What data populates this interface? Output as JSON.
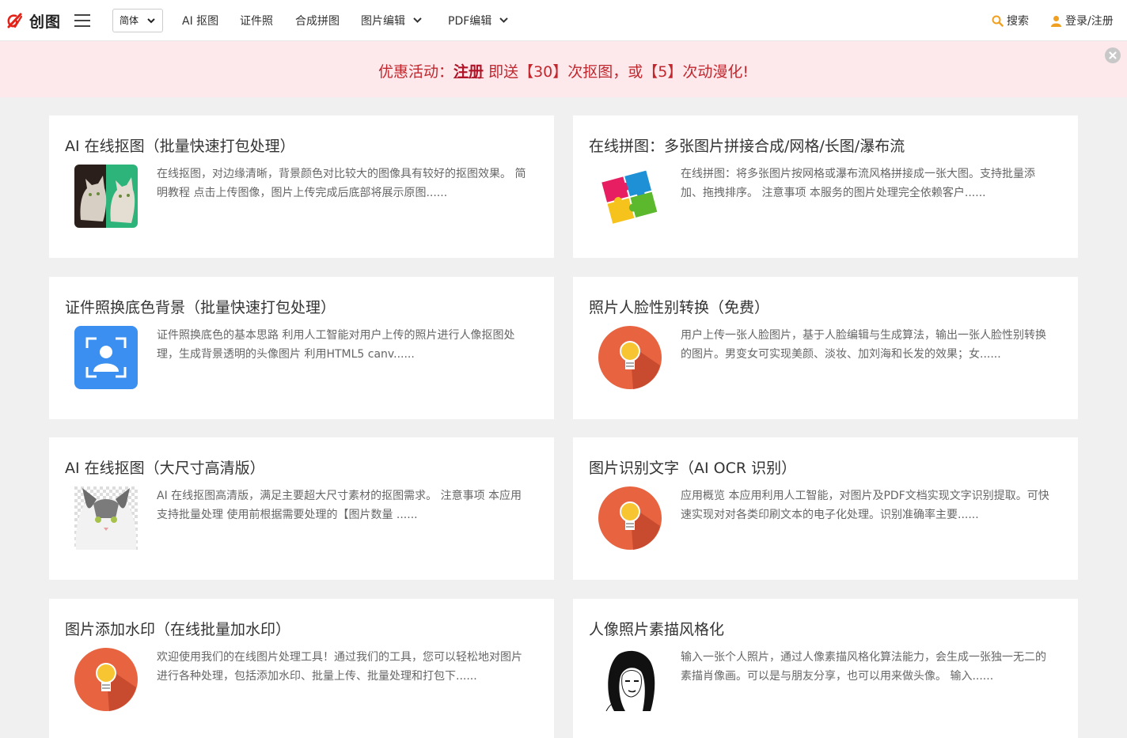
{
  "brand": {
    "name": "创图"
  },
  "header": {
    "language": "简体",
    "nav": [
      {
        "label": "AI 抠图"
      },
      {
        "label": "证件照"
      },
      {
        "label": "合成拼图"
      },
      {
        "label": "图片编辑"
      },
      {
        "label": "PDF编辑"
      }
    ],
    "search_label": "搜索",
    "login_label": "登录/注册"
  },
  "promo": {
    "prefix": "优惠活动：",
    "link": "注册",
    "suffix": " 即送【30】次抠图，或【5】次动漫化!"
  },
  "cards": [
    {
      "title": "AI 在线抠图（批量快速打包处理）",
      "desc": "在线抠图，对边缘清晰，背景颜色对比较大的图像具有较好的抠图效果。 简明教程 点击上传图像，图片上传完成后底部将展示原图......",
      "icon": "cat-cutout-icon"
    },
    {
      "title": "在线拼图：多张图片拼接合成/网格/长图/瀑布流",
      "desc": "在线拼图：将多张图片按网格或瀑布流风格拼接成一张大图。支持批量添加、拖拽排序。 注意事项 本服务的图片处理完全依赖客户......",
      "icon": "puzzle-icon"
    },
    {
      "title": "证件照换底色背景（批量快速打包处理）",
      "desc": "证件照换底色的基本思路 利用人工智能对用户上传的照片进行人像抠图处理，生成背景透明的头像图片 利用HTML5 canv......",
      "icon": "id-photo-icon"
    },
    {
      "title": "照片人脸性别转换（免费）",
      "desc": "用户上传一张人脸图片，基于人脸编辑与生成算法，输出一张人脸性别转换的图片。男变女可实现美颜、淡妆、加刘海和长发的效果；女......",
      "icon": "lightbulb-icon"
    },
    {
      "title": "AI 在线抠图（大尺寸高清版）",
      "desc": "AI 在线抠图高清版，满足主要超大尺寸素材的抠图需求。 注意事项 本应用支持批量处理 使用前根据需要处理的【图片数量 ......",
      "icon": "cat-icon"
    },
    {
      "title": "图片识别文字（AI OCR 识别）",
      "desc": "应用概览 本应用利用人工智能，对图片及PDF文档实现文字识别提取。可快速实现对对各类印刷文本的电子化处理。识别准确率主要......",
      "icon": "lightbulb-icon"
    },
    {
      "title": "图片添加水印（在线批量加水印）",
      "desc": "欢迎使用我们的在线图片处理工具！通过我们的工具，您可以轻松地对图片进行各种处理，包括添加水印、批量上传、批量处理和打包下......",
      "icon": "lightbulb-icon"
    },
    {
      "title": "人像照片素描风格化",
      "desc": "输入一张个人照片，通过人像素描风格化算法能力，会生成一张独一无二的素描肖像画。可以是与朋友分享，也可以用来做头像。 输入......",
      "icon": "sketch-portrait-icon"
    }
  ],
  "colors": {
    "accent": "#c0282e",
    "promo_bg": "#fde8ec",
    "icon_orange": "#e8633f",
    "id_blue": "#3a8ff0",
    "page_bg": "#f0f0f0"
  }
}
